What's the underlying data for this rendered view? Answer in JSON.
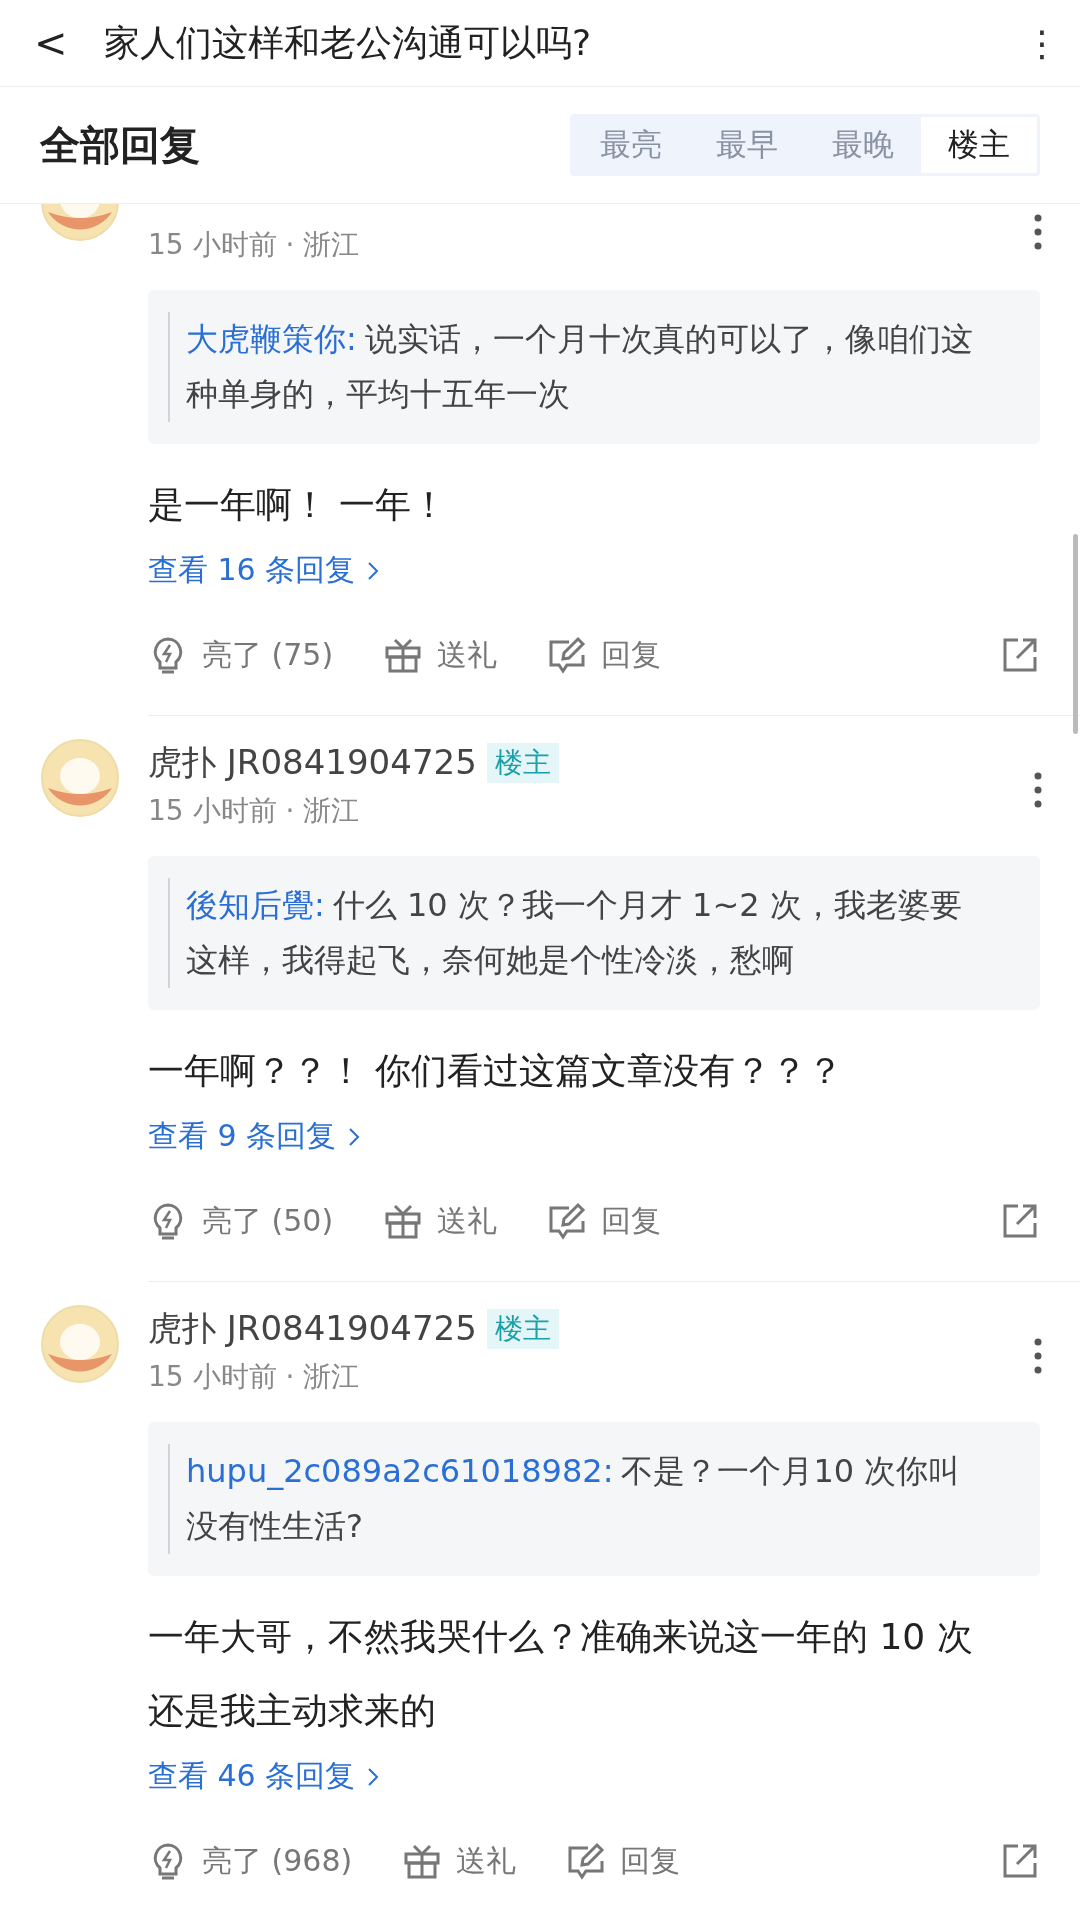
{
  "header": {
    "back": "<",
    "title": "家人们这样和老公沟通可以吗?",
    "more": "⋮"
  },
  "replies_bar": {
    "title": "全部回复",
    "tabs": [
      {
        "label": "最亮",
        "selected": false
      },
      {
        "label": "最早",
        "selected": false
      },
      {
        "label": "最晚",
        "selected": false
      },
      {
        "label": "楼主",
        "selected": true
      }
    ]
  },
  "comments": [
    {
      "cut_top": true,
      "time": "15 小时前 · 浙江",
      "quote_author": "大虎鞭策你:",
      "quote_text": "说实话，一个月十次真的可以了，像咱们这种单身的，平均十五年一次",
      "body": "是一年啊！ 一年！",
      "view_replies": "查看 16 条回复",
      "likes": "亮了 (75)",
      "gift": "送礼",
      "reply": "回复"
    },
    {
      "cut_top": false,
      "name": "虎扑 JR0841904725",
      "tag": "楼主",
      "time": "15 小时前 · 浙江",
      "quote_author": "後知后覺:",
      "quote_text": "什么 10 次？我一个月才 1~2 次，我老婆要这样，我得起飞，奈何她是个性冷淡，愁啊",
      "body": "一年啊？？！ 你们看过这篇文章没有？？？",
      "view_replies": "查看 9 条回复",
      "likes": "亮了 (50)",
      "gift": "送礼",
      "reply": "回复"
    },
    {
      "cut_top": false,
      "name": "虎扑 JR0841904725",
      "tag": "楼主",
      "time": "15 小时前 · 浙江",
      "quote_author": "hupu_2c089a2c61018982:",
      "quote_text": "不是？一个月10 次你叫没有性生活?",
      "body": "一年大哥，不然我哭什么？准确来说这一年的 10 次还是我主动求来的",
      "view_replies": "查看 46 条回复",
      "likes": "亮了 (968)",
      "gift": "送礼",
      "reply": "回复"
    }
  ]
}
